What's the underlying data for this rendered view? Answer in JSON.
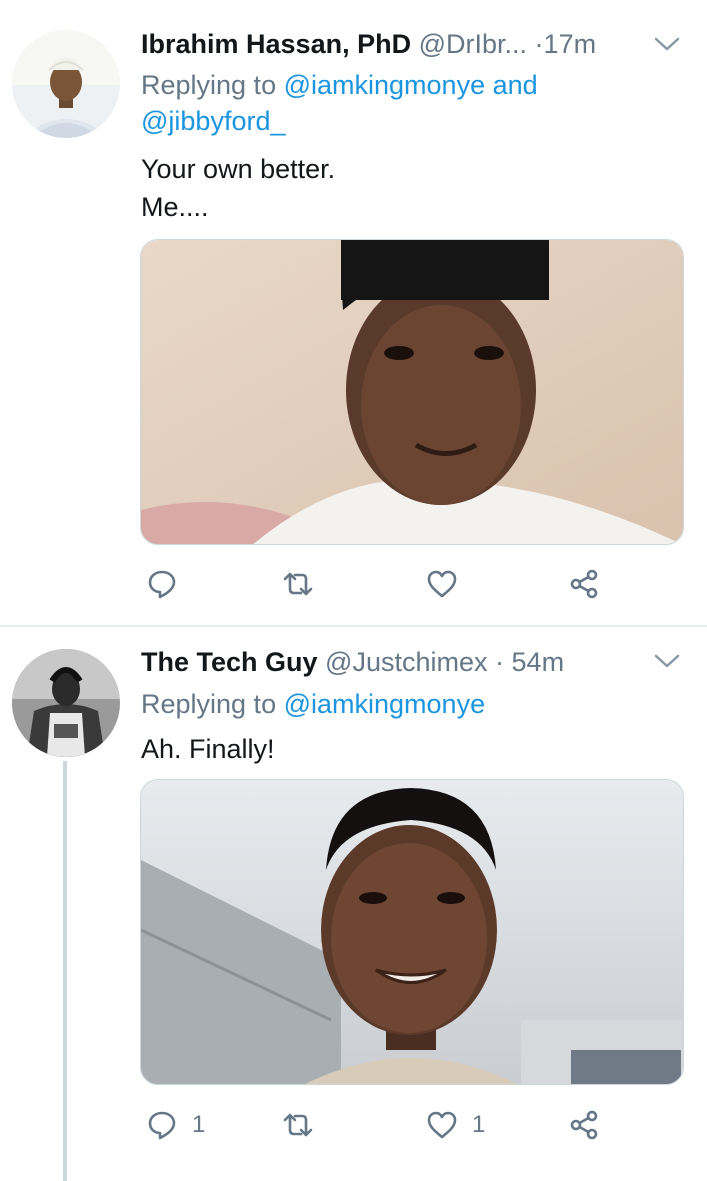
{
  "tweets": [
    {
      "name": "Ibrahim Hassan, PhD",
      "handle": "@DrIbr...",
      "separator": "·",
      "time": "17m",
      "replying_prefix": "Replying to",
      "replying_line1": "@iamkingmonye and",
      "replying_line2": "@jibbyford_",
      "text": "Your own better.\nMe....",
      "media": "photo of a man wearing a black cap",
      "actions": {
        "reply_count": "",
        "retweet_count": "",
        "like_count": ""
      }
    },
    {
      "name": "The Tech Guy",
      "handle": "@Justchimex",
      "separator": "·",
      "time": "54m",
      "replying_prefix": "Replying to",
      "replying_line1": "@iamkingmonye",
      "text": "Ah. Finally!",
      "media": "selfie of a smiling young man",
      "actions": {
        "reply_count": "1",
        "retweet_count": "",
        "like_count": "1"
      }
    }
  ],
  "colors": {
    "link": "#1b95e0",
    "secondary_text": "#657786",
    "primary_text": "#14171a",
    "divider": "#e6ecf0",
    "thread_line": "#ccd6dd"
  },
  "icons": [
    "chevron-down-icon",
    "reply-icon",
    "retweet-icon",
    "like-icon",
    "share-icon"
  ]
}
